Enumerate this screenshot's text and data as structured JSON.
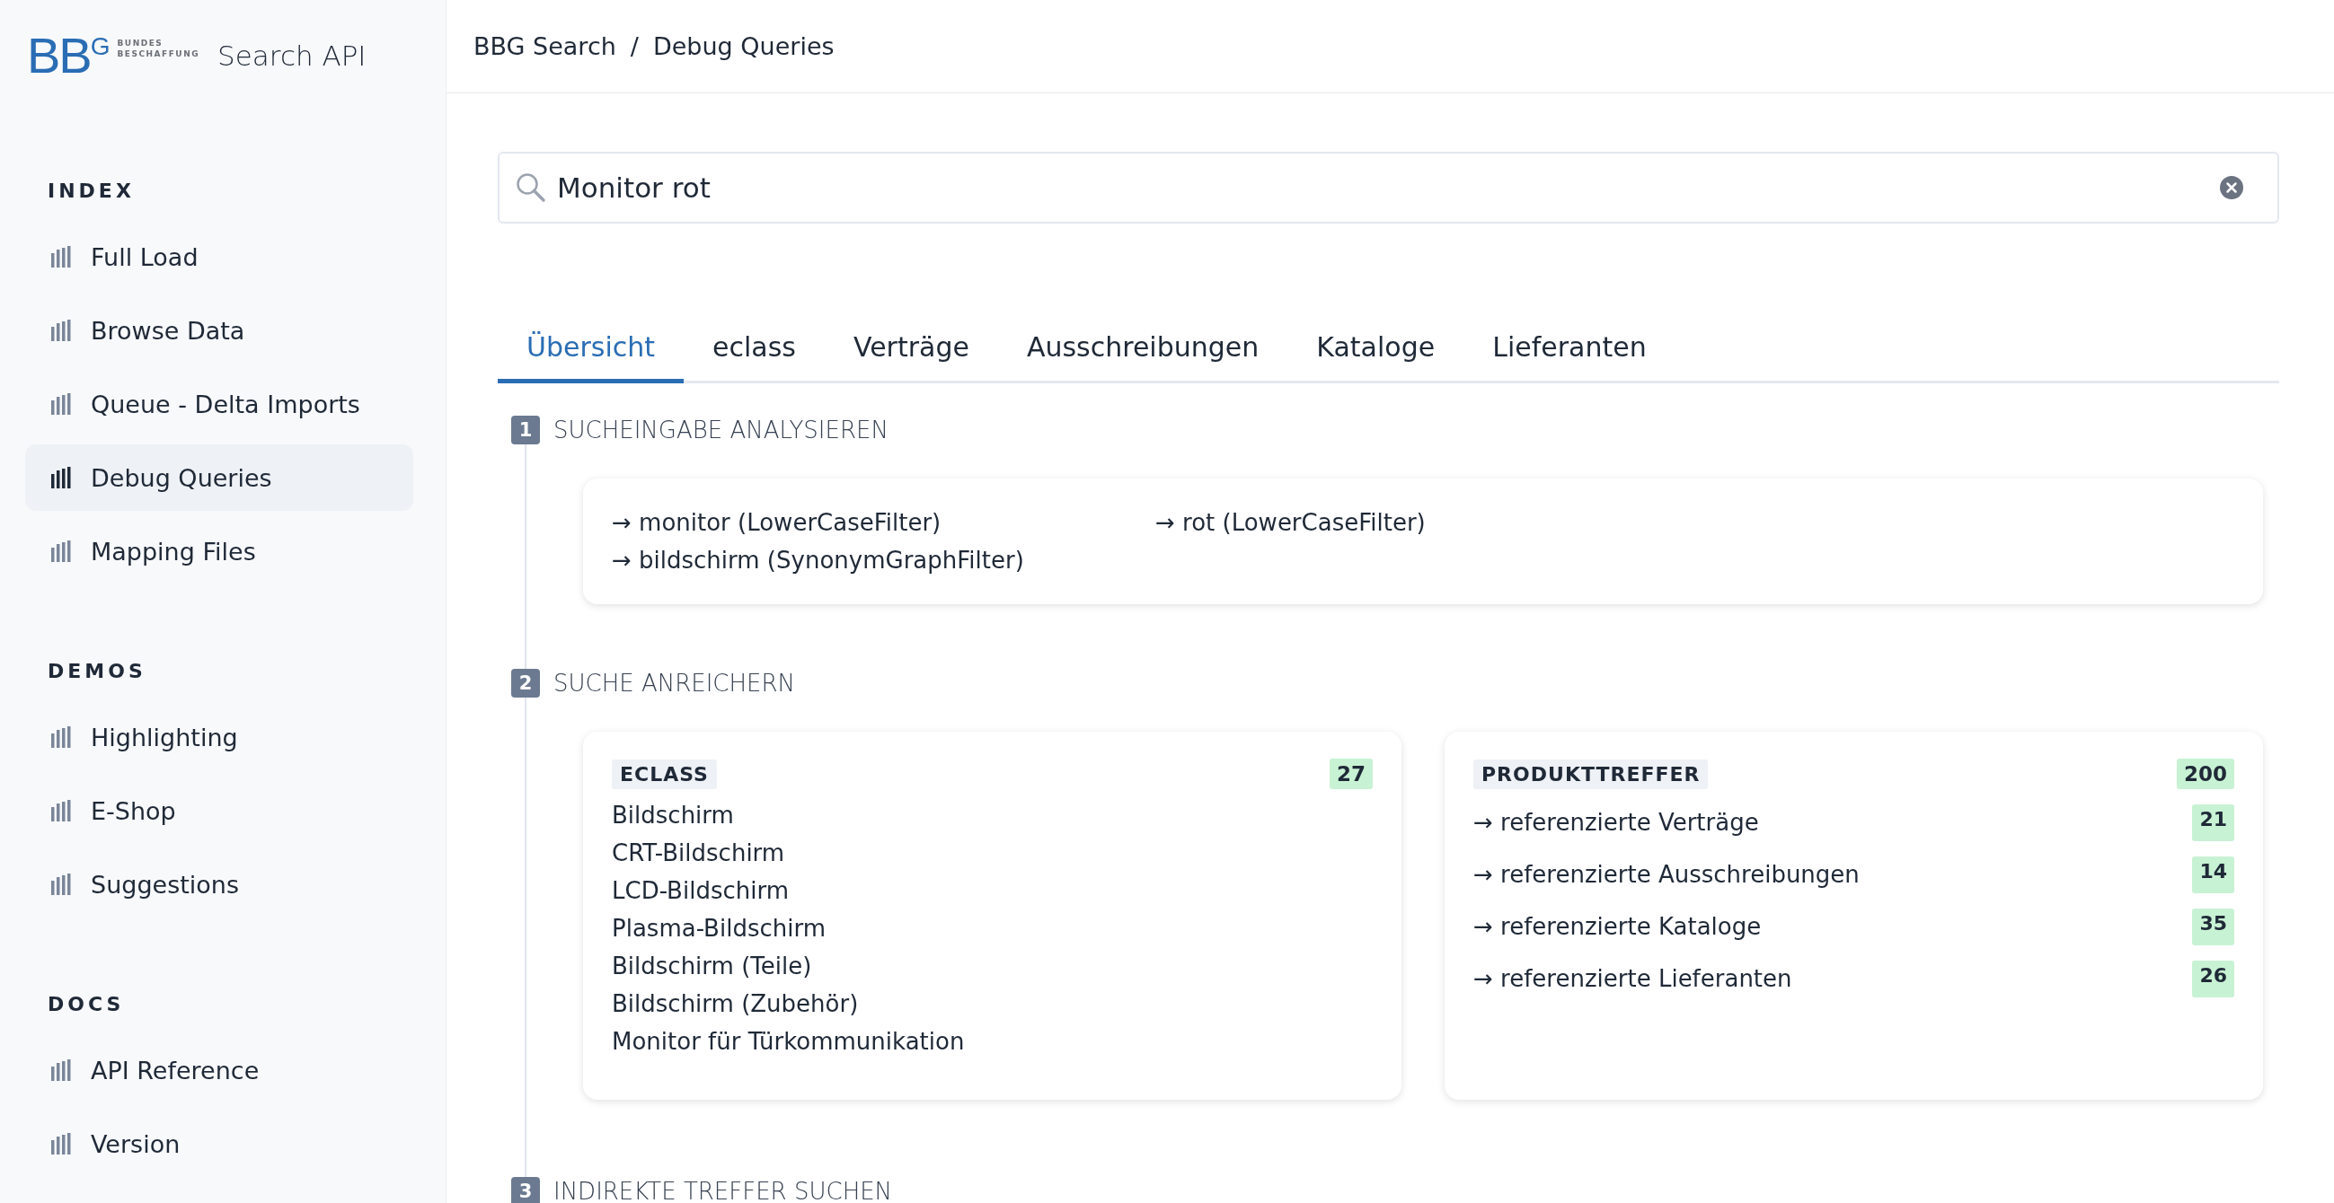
{
  "sidebar": {
    "logo": {
      "letters": "BB",
      "mark": "G",
      "lines": [
        "BUNDES",
        "BESCHAFFUNG"
      ]
    },
    "app_title": "Search API",
    "sections": [
      {
        "title": "INDEX",
        "items": [
          {
            "label": "Full Load",
            "selected": false
          },
          {
            "label": "Browse Data",
            "selected": false
          },
          {
            "label": "Queue - Delta Imports",
            "selected": false
          },
          {
            "label": "Debug Queries",
            "selected": true
          },
          {
            "label": "Mapping Files",
            "selected": false
          }
        ]
      },
      {
        "title": "DEMOS",
        "items": [
          {
            "label": "Highlighting",
            "selected": false
          },
          {
            "label": "E-Shop",
            "selected": false
          },
          {
            "label": "Suggestions",
            "selected": false
          }
        ]
      },
      {
        "title": "DOCS",
        "items": [
          {
            "label": "API Reference",
            "selected": false
          },
          {
            "label": "Version",
            "selected": false
          }
        ]
      }
    ]
  },
  "breadcrumb": {
    "items": [
      "BBG Search",
      "Debug Queries"
    ],
    "separator": "/"
  },
  "search": {
    "value": "Monitor rot"
  },
  "tabs": [
    {
      "label": "Übersicht",
      "selected": true
    },
    {
      "label": "eclass",
      "selected": false
    },
    {
      "label": "Verträge",
      "selected": false
    },
    {
      "label": "Ausschreibungen",
      "selected": false
    },
    {
      "label": "Kataloge",
      "selected": false
    },
    {
      "label": "Lieferanten",
      "selected": false
    }
  ],
  "steps": [
    {
      "number": "1",
      "title": "SUCHEINGABE ANALYSIEREN",
      "kind": "tokens",
      "token_columns": [
        [
          "→ monitor (LowerCaseFilter)",
          "→ bildschirm (SynonymGraphFilter)"
        ],
        [
          "→ rot (LowerCaseFilter)"
        ]
      ]
    },
    {
      "number": "2",
      "title": "SUCHE ANREICHERN",
      "kind": "cards",
      "cards": [
        {
          "tag": "ECLASS",
          "count": "27",
          "items": [
            {
              "label": "Bildschirm"
            },
            {
              "label": "CRT-Bildschirm"
            },
            {
              "label": "LCD-Bildschirm"
            },
            {
              "label": "Plasma-Bildschirm"
            },
            {
              "label": "Bildschirm (Teile)"
            },
            {
              "label": "Bildschirm (Zubehör)"
            },
            {
              "label": "Monitor für Türkommunikation"
            }
          ]
        },
        {
          "tag": "PRODUKTTREFFER",
          "count": "200",
          "items": [
            {
              "label": "→ referenzierte Verträge",
              "count": "21"
            },
            {
              "label": "→ referenzierte Ausschreibungen",
              "count": "14"
            },
            {
              "label": "→ referenzierte Kataloge",
              "count": "35"
            },
            {
              "label": "→ referenzierte Lieferanten",
              "count": "26"
            }
          ]
        }
      ]
    },
    {
      "number": "3",
      "title": "INDIREKTE TREFFER SUCHEN",
      "kind": "empty"
    }
  ]
}
